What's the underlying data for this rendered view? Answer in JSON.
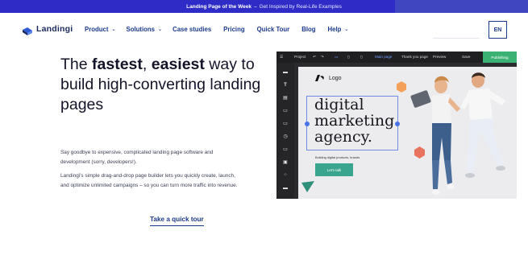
{
  "announcement": {
    "bold": "Landing Page of the Week",
    "separator": "–",
    "link": "Get Inspired by Real-Life Examples"
  },
  "nav": {
    "logo_text": "Landingi",
    "items": [
      {
        "label": "Product",
        "has_dropdown": true
      },
      {
        "label": "Solutions",
        "has_dropdown": true
      },
      {
        "label": "Case studies",
        "has_dropdown": false
      },
      {
        "label": "Pricing",
        "has_dropdown": false
      },
      {
        "label": "Quick Tour",
        "has_dropdown": false
      },
      {
        "label": "Blog",
        "has_dropdown": false
      },
      {
        "label": "Help",
        "has_dropdown": true
      }
    ],
    "language": "EN"
  },
  "hero": {
    "headline_pre": "The ",
    "headline_bold1": "fastest",
    "headline_mid": ", ",
    "headline_bold2": "easiest",
    "headline_rest": " way to build high-converting landing pages",
    "para1": "Say goodbye to expensive, complicated landing page software and development (sorry, developers!).",
    "para2": "Landingi's simple drag-and-drop page builder lets you quickly create, launch, and optimize unlimited campaigns – so you can turn more traffic into revenue.",
    "cta": "Take a quick tour"
  },
  "editor": {
    "project_label": "Project",
    "main_page": "Main page",
    "thank_you_page": "Thank you page",
    "preview": "Preview",
    "save": "Save",
    "publishing": "Publishing",
    "canvas": {
      "logo": "Logo",
      "headline_lines": [
        "digital",
        "marketing",
        "agency."
      ],
      "tagline": "Building digital products, brands",
      "button": "Let's talk"
    }
  },
  "colors": {
    "announcement_bg": "#2e2bc6",
    "brand_navy": "#1b3a8a",
    "publish_green": "#3bb273",
    "cta_teal": "#39a58f",
    "accent_orange": "#f4a25b",
    "accent_red": "#e8735f"
  }
}
